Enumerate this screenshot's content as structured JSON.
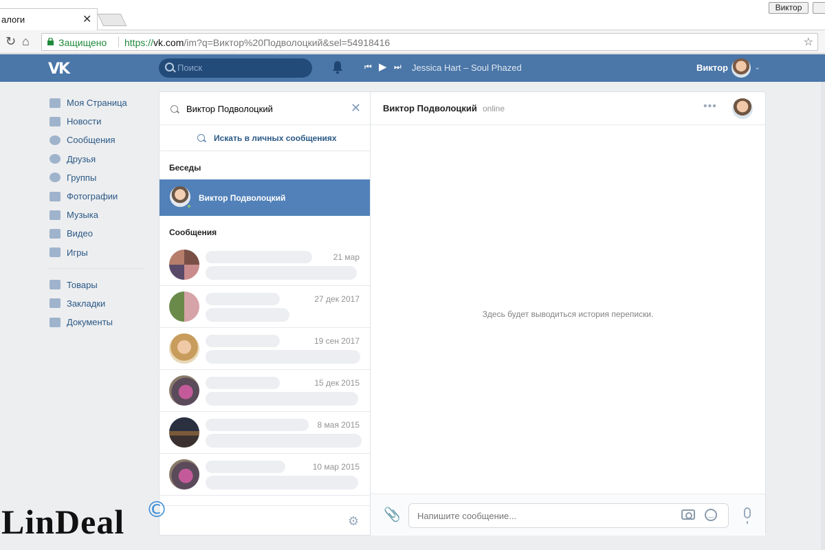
{
  "browser": {
    "tab_title": "алоги",
    "profile_button": "Виктор",
    "secure_label": "Защищено",
    "url_scheme": "https://",
    "url_domain": "vk.com",
    "url_path": "/im?q=Виктор%20Подволоцкий&sel=54918416"
  },
  "header": {
    "search_placeholder": "Поиск",
    "now_playing": "Jessica Hart – Soul Phazed",
    "user_name": "Виктор"
  },
  "sidebar": {
    "items": [
      {
        "label": "Моя Страница",
        "icon": "home-icon"
      },
      {
        "label": "Новости",
        "icon": "news-icon"
      },
      {
        "label": "Сообщения",
        "icon": "messages-icon"
      },
      {
        "label": "Друзья",
        "icon": "friends-icon"
      },
      {
        "label": "Группы",
        "icon": "groups-icon"
      },
      {
        "label": "Фотографии",
        "icon": "photos-icon"
      },
      {
        "label": "Музыка",
        "icon": "music-icon"
      },
      {
        "label": "Видео",
        "icon": "video-icon"
      },
      {
        "label": "Игры",
        "icon": "games-icon"
      }
    ],
    "extra_items": [
      {
        "label": "Товары",
        "icon": "market-icon"
      },
      {
        "label": "Закладки",
        "icon": "bookmarks-icon"
      },
      {
        "label": "Документы",
        "icon": "documents-icon"
      }
    ]
  },
  "conversations": {
    "search_query": "Виктор Подволоцкий",
    "search_in_messages": "Искать в личных сообщениях",
    "section_chats": "Беседы",
    "active_chat_name": "Виктор Подволоцкий",
    "section_messages": "Сообщения",
    "messages": [
      {
        "date": "21 мар"
      },
      {
        "date": "27 дек 2017"
      },
      {
        "date": "19 сен 2017"
      },
      {
        "date": "15 дек 2015"
      },
      {
        "date": "8 мая 2015"
      },
      {
        "date": "10 мар 2015"
      }
    ]
  },
  "chat": {
    "name": "Виктор Подволоцкий",
    "status": "online",
    "empty_text": "Здесь будет выводиться история переписки.",
    "input_placeholder": "Напишите сообщение..."
  },
  "watermark": {
    "text": "LinDeal",
    "symbol": "©"
  },
  "colors": {
    "vk_blue": "#4a76a8",
    "active_row": "#5181b8",
    "link": "#2a5885",
    "online": "#8ac176"
  }
}
